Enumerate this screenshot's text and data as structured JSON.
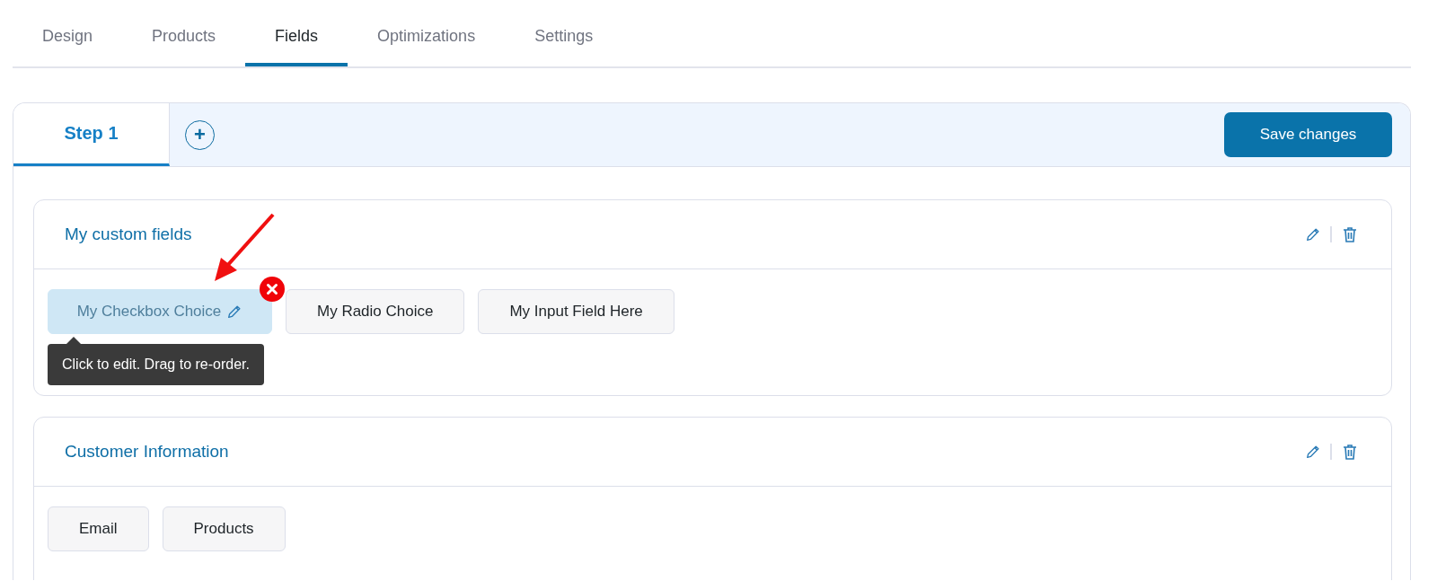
{
  "tabs": [
    {
      "label": "Design",
      "selected": false
    },
    {
      "label": "Products",
      "selected": false
    },
    {
      "label": "Fields",
      "selected": true
    },
    {
      "label": "Optimizations",
      "selected": false
    },
    {
      "label": "Settings",
      "selected": false
    }
  ],
  "steps": [
    {
      "label": "Step 1",
      "selected": true
    }
  ],
  "add_step": "+",
  "save_button": "Save changes",
  "sections": [
    {
      "title": "My custom fields",
      "fields": [
        {
          "label": "My Checkbox Choice",
          "selected": true
        },
        {
          "label": "My Radio Choice",
          "selected": false
        },
        {
          "label": "My Input Field Here",
          "selected": false
        }
      ]
    },
    {
      "title": "Customer Information",
      "fields": [
        {
          "label": "Email",
          "selected": false
        },
        {
          "label": "Products",
          "selected": false
        }
      ]
    }
  ],
  "tooltip": "Click to edit. Drag to re-order."
}
